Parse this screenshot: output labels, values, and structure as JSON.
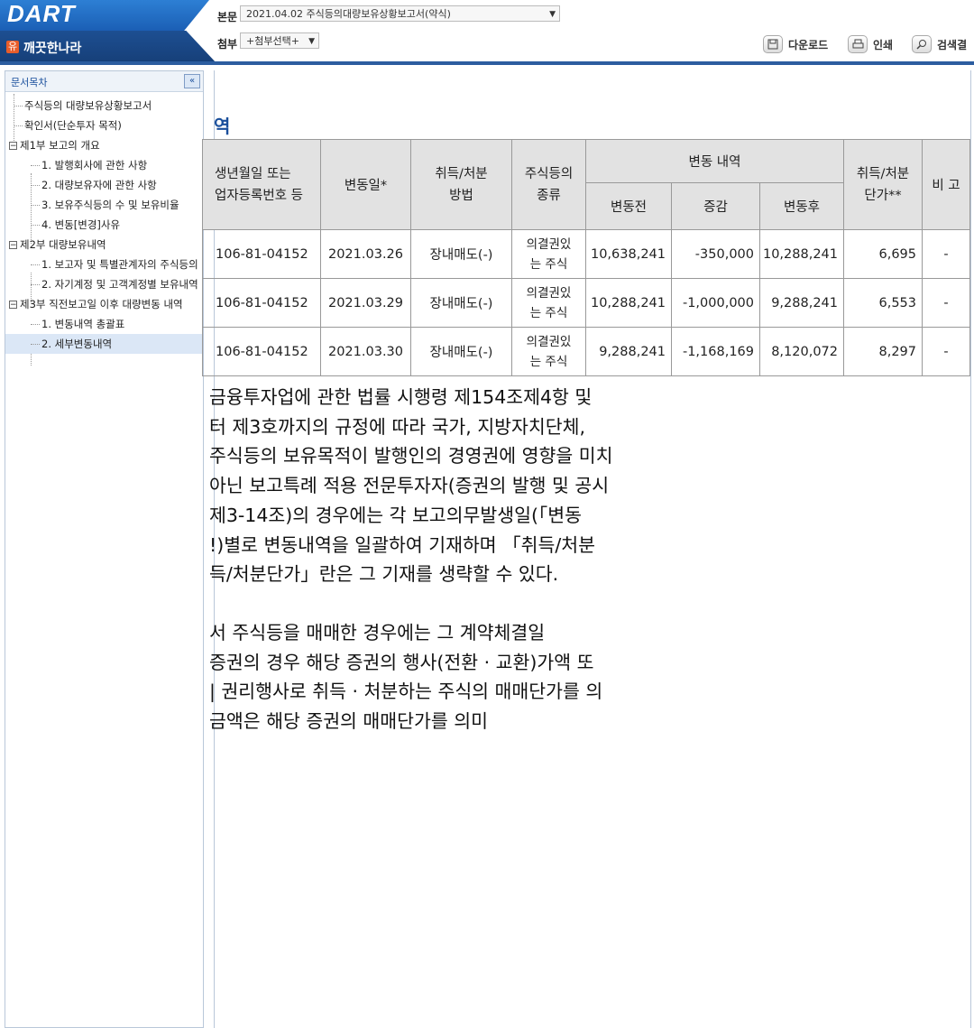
{
  "header": {
    "logo": "DART",
    "company_icon": "유",
    "company": "깨끗한나라",
    "body_label": "본문",
    "body_select": "2021.04.02  주식등의대량보유상황보고서(약식)",
    "attach_label": "첨부",
    "attach_select": "+첨부선택+",
    "download": "다운로드",
    "print": "인쇄",
    "search": "검색결"
  },
  "sidebar": {
    "title": "문서목차",
    "collapse": "«",
    "items": [
      {
        "label": "주식등의 대량보유상황보고서"
      },
      {
        "label": "확인서(단순투자 목적)"
      },
      {
        "label": "제1부 보고의 개요"
      },
      {
        "label": "1. 발행회사에 관한 사항"
      },
      {
        "label": "2. 대량보유자에 관한 사항"
      },
      {
        "label": "3. 보유주식등의 수 및 보유비율"
      },
      {
        "label": "4. 변동[변경]사유"
      },
      {
        "label": "제2부 대량보유내역"
      },
      {
        "label": "1. 보고자 및 특별관계자의 주식등의"
      },
      {
        "label": "2. 자기계정 및 고객계정별 보유내역"
      },
      {
        "label": "제3부 직전보고일 이후 대량변동 내역"
      },
      {
        "label": "1. 변동내역 총괄표"
      },
      {
        "label": "2. 세부변동내역"
      }
    ]
  },
  "main": {
    "heading_fragment": "역",
    "table": {
      "col_id_1": "생년월일 또는",
      "col_id_2": "업자등록번호 등",
      "col_date": "변동일*",
      "col_method_1": "취득/처분",
      "col_method_2": "방법",
      "col_type_1": "주식등의",
      "col_type_2": "종류",
      "col_change": "변동 내역",
      "col_before": "변동전",
      "col_delta": "증감",
      "col_after": "변동후",
      "col_price_1": "취득/처분",
      "col_price_2": "단가**",
      "col_note": "비 고",
      "rows": [
        {
          "id": "106-81-04152",
          "date": "2021.03.26",
          "method": "장내매도(-)",
          "type_1": "의결권있",
          "type_2": "는 주식",
          "before": "10,638,241",
          "delta": "-350,000",
          "after": "10,288,241",
          "price": "6,695",
          "note": "-"
        },
        {
          "id": "106-81-04152",
          "date": "2021.03.29",
          "method": "장내매도(-)",
          "type_1": "의결권있",
          "type_2": "는 주식",
          "before": "10,288,241",
          "delta": "-1,000,000",
          "after": "9,288,241",
          "price": "6,553",
          "note": "-"
        },
        {
          "id": "106-81-04152",
          "date": "2021.03.30",
          "method": "장내매도(-)",
          "type_1": "의결권있",
          "type_2": "는 주식",
          "before": "9,288,241",
          "delta": "-1,168,169",
          "after": "8,120,072",
          "price": "8,297",
          "note": "-"
        }
      ]
    },
    "notes": [
      "금융투자업에 관한 법률 시행령 제154조제4항 및",
      "터 제3호까지의 규정에 따라 국가, 지방자치단체,",
      "주식등의 보유목적이 발행인의 경영권에 영향을 미치",
      "아닌 보고특례 적용 전문투자자(증권의 발행 및 공시",
      "제3-14조)의 경우에는 각 보고의무발생일(「변동",
      "!)별로 변동내역을 일괄하여 기재하며 「취득/처분",
      "득/처분단가」란은 그 기재를 생략할 수 있다.",
      "",
      "서 주식등을 매매한 경우에는 그 계약체결일",
      "증권의 경우 해당 증권의 행사(전환 · 교환)가액 또",
      "| 권리행사로 취득 · 처분하는 주식의 매매단가를 의",
      "금액은 해당 증권의 매매단가를 의미"
    ]
  }
}
